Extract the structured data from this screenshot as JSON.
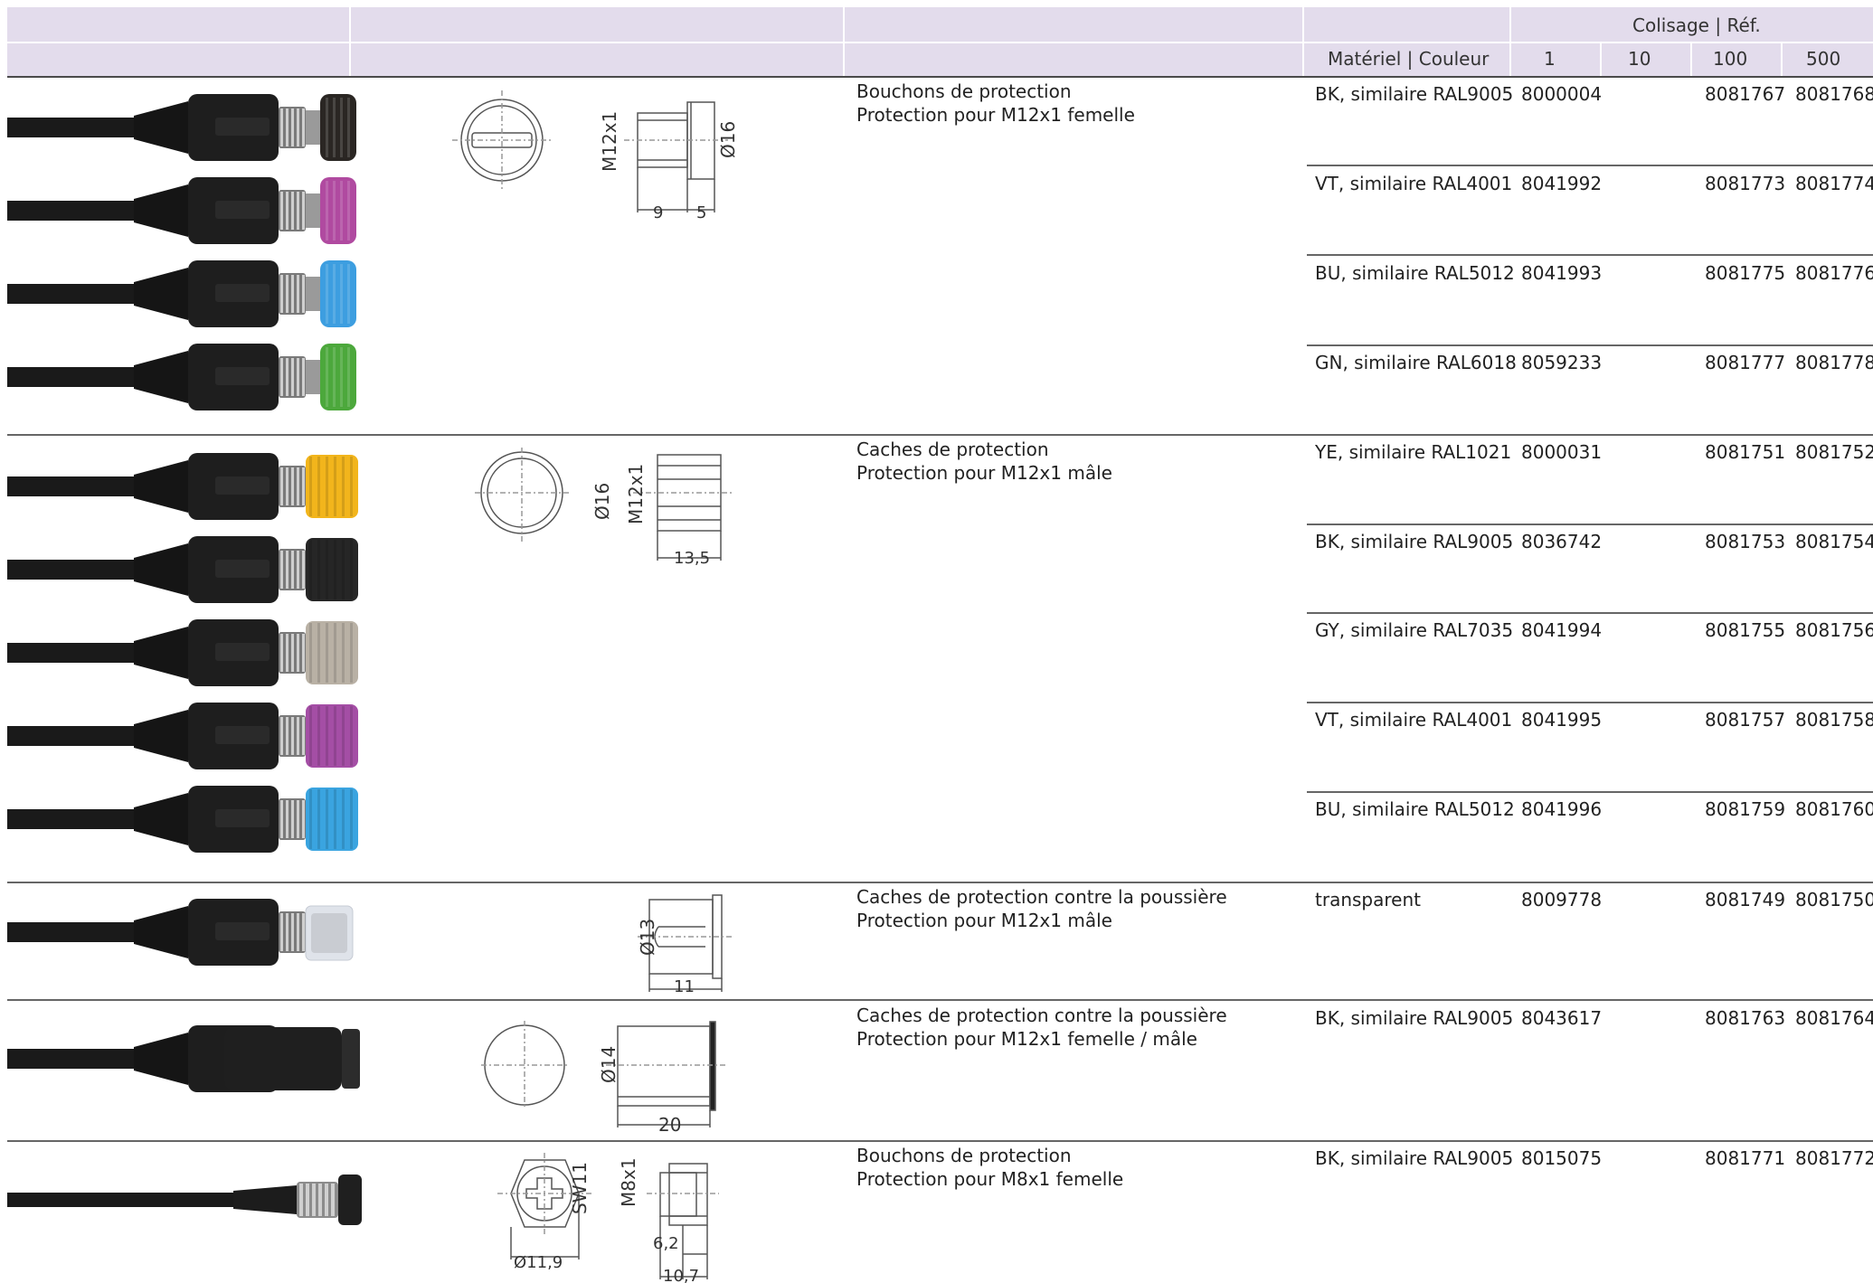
{
  "header": {
    "colisage_label": "Colisage | Réf.",
    "material_label": "Matériel | Couleur",
    "qty_1": "1",
    "qty_10": "10",
    "qty_100": "100",
    "qty_500": "500"
  },
  "groups": [
    {
      "title": "Bouchons de protection",
      "subtitle": "Protection pour M12x1 femelle",
      "drawing_labels": [
        "M12x1",
        "Ø16",
        "9",
        "5"
      ],
      "rows": [
        {
          "material": "BK, similaire RAL9005",
          "ref_1": "8000004",
          "ref_10": "",
          "ref_100": "8081767",
          "ref_500": "8081768",
          "cap_color": "#2a2623"
        },
        {
          "material": "VT, similaire RAL4001",
          "ref_1": "8041992",
          "ref_10": "",
          "ref_100": "8081773",
          "ref_500": "8081774",
          "cap_color": "#b04aa0"
        },
        {
          "material": "BU, similaire RAL5012",
          "ref_1": "8041993",
          "ref_10": "",
          "ref_100": "8081775",
          "ref_500": "8081776",
          "cap_color": "#3d9ee0"
        },
        {
          "material": "GN, similaire RAL6018",
          "ref_1": "8059233",
          "ref_10": "",
          "ref_100": "8081777",
          "ref_500": "8081778",
          "cap_color": "#4ca83c"
        }
      ]
    },
    {
      "title": "Caches de protection",
      "subtitle": "Protection pour M12x1 mâle",
      "drawing_labels": [
        "Ø16",
        "M12x1",
        "13,5"
      ],
      "rows": [
        {
          "material": "YE, similaire RAL1021",
          "ref_1": "8000031",
          "ref_10": "",
          "ref_100": "8081751",
          "ref_500": "8081752",
          "cap_color": "#f2b51c"
        },
        {
          "material": "BK, similaire RAL9005",
          "ref_1": "8036742",
          "ref_10": "",
          "ref_100": "8081753",
          "ref_500": "8081754",
          "cap_color": "#262626"
        },
        {
          "material": "GY, similaire RAL7035",
          "ref_1": "8041994",
          "ref_10": "",
          "ref_100": "8081755",
          "ref_500": "8081756",
          "cap_color": "#b9b1a5"
        },
        {
          "material": "VT, similaire RAL4001",
          "ref_1": "8041995",
          "ref_10": "",
          "ref_100": "8081757",
          "ref_500": "8081758",
          "cap_color": "#a44ea5"
        },
        {
          "material": "BU, similaire RAL5012",
          "ref_1": "8041996",
          "ref_10": "",
          "ref_100": "8081759",
          "ref_500": "8081760",
          "cap_color": "#3aa4e0"
        }
      ]
    },
    {
      "title": "Caches de protection contre la poussière",
      "subtitle": "Protection pour M12x1 mâle",
      "drawing_labels": [
        "Ø13",
        "11"
      ],
      "rows": [
        {
          "material": "transparent",
          "ref_1": "8009778",
          "ref_10": "",
          "ref_100": "8081749",
          "ref_500": "8081750",
          "cap_color": "#dfe3ea"
        }
      ]
    },
    {
      "title": "Caches de protection contre la poussière",
      "subtitle": "Protection pour M12x1 femelle / mâle",
      "drawing_labels": [
        "Ø14",
        "20"
      ],
      "rows": [
        {
          "material": "BK, similaire RAL9005",
          "ref_1": "8043617",
          "ref_10": "",
          "ref_100": "8081763",
          "ref_500": "8081764",
          "cap_color": "#1f1f1f"
        }
      ]
    },
    {
      "title": "Bouchons de protection",
      "subtitle": "Protection pour M8x1 femelle",
      "drawing_labels": [
        "SW11",
        "M8x1",
        "Ø11,9",
        "6,2",
        "10,7"
      ],
      "rows": [
        {
          "material": "BK, similaire RAL9005",
          "ref_1": "8015075",
          "ref_10": "",
          "ref_100": "8081771",
          "ref_500": "8081772",
          "cap_color": "#1f1f1f"
        }
      ]
    }
  ]
}
